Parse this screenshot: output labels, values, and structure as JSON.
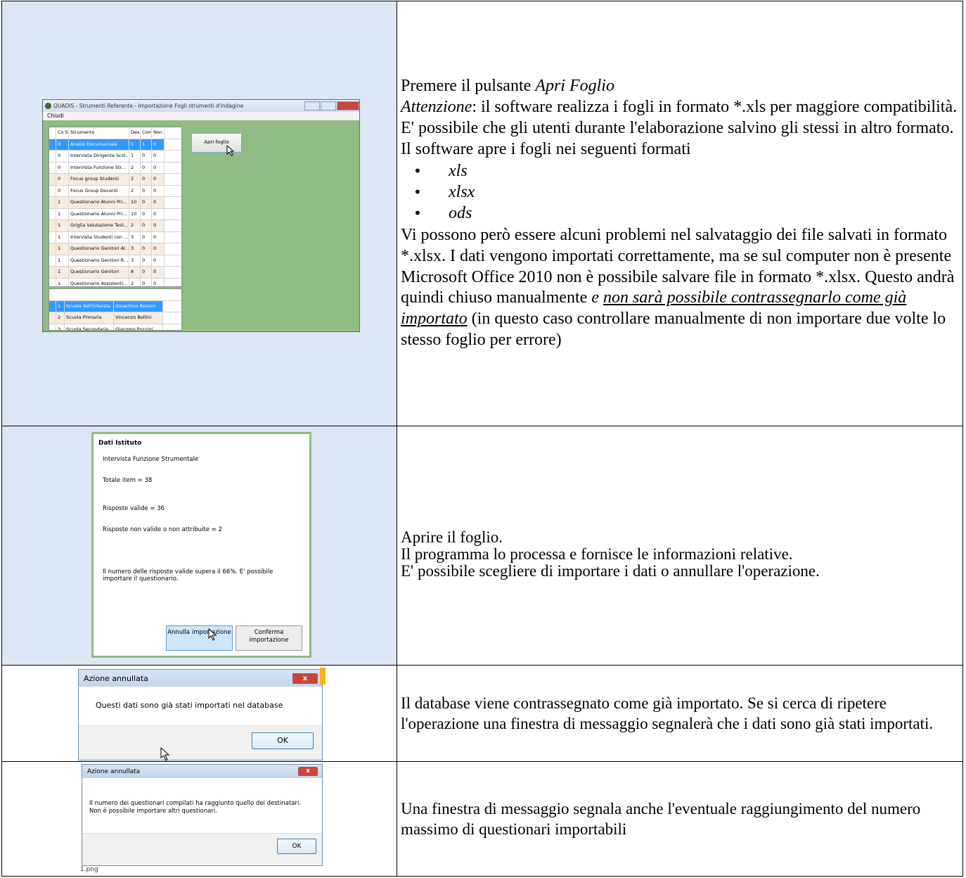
{
  "rows": [
    {
      "screenshot": {
        "window_title": "QUADIS - Strumenti Referente - Importazione Fogli strumenti d'indagine",
        "menu_item": "Chiudi",
        "button_label": "Apri foglio",
        "grid1_headers": [
          "Co Sc",
          "Strumento",
          "Des",
          "Com",
          "Non Com"
        ],
        "grid1_rows": [
          [
            "0",
            "Analisi Documentale",
            "1",
            "1",
            "0"
          ],
          [
            "0",
            "Intervista Dirigente Scol...",
            "1",
            "0",
            "0"
          ],
          [
            "0",
            "Intervista Funzione Str...",
            "2",
            "0",
            "0"
          ],
          [
            "0",
            "Focus group Studenti",
            "2",
            "0",
            "0"
          ],
          [
            "0",
            "Focus Group Docenti",
            "2",
            "0",
            "0"
          ],
          [
            "1",
            "Questionario Alunni Pri...",
            "10",
            "0",
            "0"
          ],
          [
            "1",
            "Questionario Alunni Pri...",
            "10",
            "0",
            "0"
          ],
          [
            "1",
            "Griglia Valutazione Test...",
            "2",
            "0",
            "0"
          ],
          [
            "1",
            "Intervista Studenti con ...",
            "3",
            "0",
            "0"
          ],
          [
            "1",
            "Questionario Genitori Al...",
            "3",
            "0",
            "0"
          ],
          [
            "1",
            "Questionario Genitori R...",
            "3",
            "0",
            "0"
          ],
          [
            "1",
            "Questionario Genitori",
            "8",
            "0",
            "0"
          ],
          [
            "1",
            "Questionario Assistenti...",
            "2",
            "0",
            "0"
          ]
        ],
        "grid2_rows": [
          [
            "1",
            "Scuola dell'Infanzia",
            "Gioachino Rossini"
          ],
          [
            "2",
            "Scuola Primaria",
            "Vincenzo Bellini"
          ],
          [
            "3",
            "Scuola Secondaria...",
            "Giacomo Puccini"
          ]
        ]
      },
      "text": {
        "line1_prefix": "Premere il pulsante ",
        "line1_italic": "Apri Foglio",
        "attention_italic": "Attenzione",
        "attention_body": ": il software realizza i fogli in formato *.xls per maggiore compatibilità. E' possibile che gli utenti durante l'elaborazione salvino gli stessi in altro formato. Il software apre i fogli nei seguenti formati",
        "formats": [
          "xls",
          "xlsx",
          "ods"
        ],
        "body2": "Vi possono però essere alcuni problemi nel salvataggio dei file salvati in formato *.xlsx. I dati vengono importati correttamente, ma se sul computer non è presente Microsoft Office 2010 non è possibile salvare file in formato *.xlsx. Questo andrà quindi  chiuso manualmente ",
        "italic_e": "e ",
        "italic_underlined": "non sarà possibile contrassegnarlo come già importato",
        "tail": " (in questo caso controllare manualmente di non importare due volte lo stesso foglio per errore)"
      }
    },
    {
      "screenshot": {
        "title": "Dati Istituto",
        "instrument": "Intervista Funzione Strumentale",
        "total_items": "Totale item = 38",
        "valid": "Risposte valide = 36",
        "invalid": "Risposte non valide o non attribuite = 2",
        "note": "Il numero delle risposte valide supera il 66%. E' possibile importare il questionario.",
        "cancel_button": "Annulla importazione",
        "confirm_button": "Conferma importazione"
      },
      "text": {
        "line1": "Aprire il foglio.",
        "line2": "Il programma lo processa e fornisce le informazioni relative.",
        "line3": "E' possibile scegliere di importare i dati o annullare l'operazione."
      }
    },
    {
      "screenshot": {
        "title": "Azione annullata",
        "message": "Questi dati sono già stati importati nel database",
        "ok": "OK",
        "close": "x"
      },
      "text": "Il database viene contrassegnato come già importato. Se si cerca di ripetere l'operazione una finestra di messaggio segnalerà che i dati sono già stati importati."
    },
    {
      "screenshot": {
        "title": "Azione annullata",
        "message1": "Il numero dei questionari compilati ha raggiunto quello dei destinatari.",
        "message2": "Non è possibile importare altri questionari.",
        "ok": "OK",
        "close": "x",
        "behind_label": "1.png"
      },
      "text": "Una finestra di messaggio segnala anche l'eventuale raggiungimento del numero massimo di questionari importabili"
    }
  ]
}
